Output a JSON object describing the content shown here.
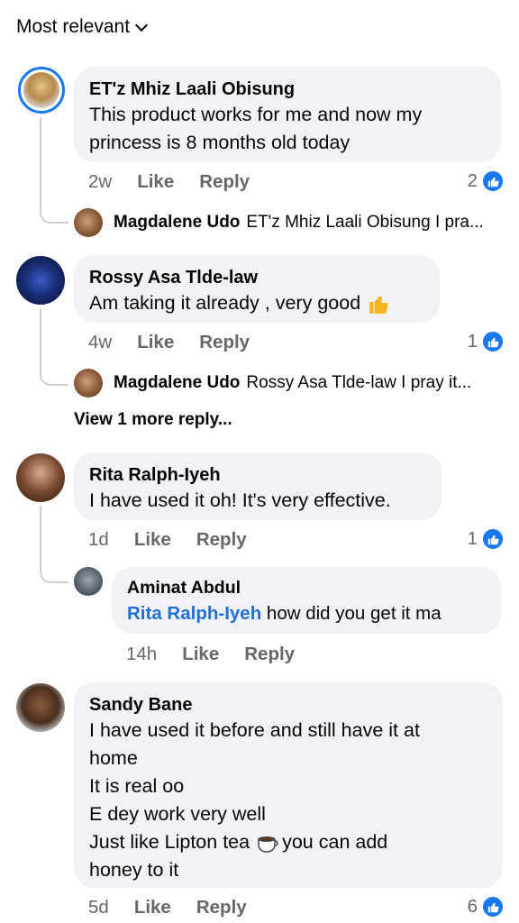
{
  "sort_label": "Most relevant",
  "comments": [
    {
      "author": "ET'z Mhiz Laali Obisung",
      "lines": [
        "This product works for me and now my",
        "princess is 8 months old today"
      ],
      "time": "2w",
      "like_label": "Like",
      "reply_label": "Reply",
      "reactions": "2",
      "reply_preview": {
        "author": "Magdalene Udo",
        "text": "ET'z Mhiz Laali Obisung I pra..."
      }
    },
    {
      "author": "Rossy Asa Tlde-law",
      "lines": [
        "Am taking it already , very good"
      ],
      "time": "4w",
      "like_label": "Like",
      "reply_label": "Reply",
      "reactions": "1",
      "reply_preview": {
        "author": "Magdalene Udo",
        "text": "Rossy Asa Tlde-law I pray it..."
      },
      "more_replies": "View 1 more reply..."
    },
    {
      "author": "Rita Ralph-Iyeh",
      "lines": [
        "I have used it oh! It's very effective."
      ],
      "time": "1d",
      "like_label": "Like",
      "reply_label": "Reply",
      "reactions": "1",
      "reply": {
        "author": "Aminat Abdul",
        "tag": "Rita Ralph-Iyeh",
        "text": " how did you get it ma",
        "time": "14h",
        "like_label": "Like",
        "reply_label": "Reply"
      }
    },
    {
      "author": "Sandy Bane",
      "lines": [
        "I have used it before and still have it at",
        "home",
        "It is real oo",
        "E dey work very well",
        "Just like Lipton tea",
        "honey to it"
      ],
      "line5_suffix": " you can add",
      "time": "5d",
      "like_label": "Like",
      "reply_label": "Reply",
      "reactions": "6"
    }
  ],
  "colors": {
    "bubble": "#f0f2f5",
    "like_blue": "#1877f2",
    "tag_blue": "#216fdb",
    "meta_gray": "#65676b"
  }
}
